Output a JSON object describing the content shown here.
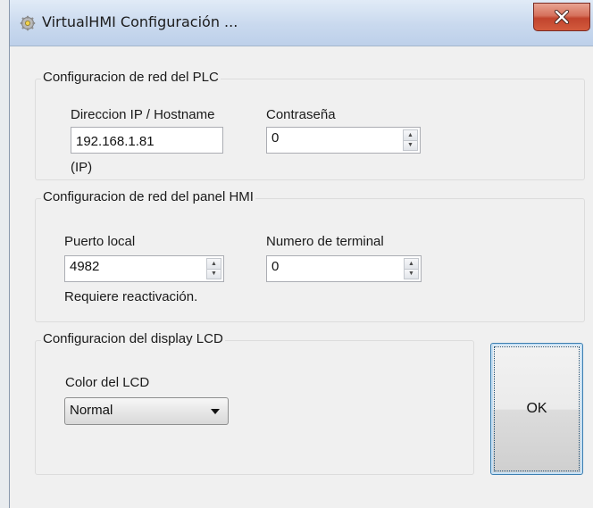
{
  "window": {
    "title": "VirtualHMI Configuración ...",
    "app_icon": "gear-icon",
    "close_icon": "close-icon"
  },
  "plc_group": {
    "title": "Configuracion de red del PLC",
    "ip_label": "Direccion IP / Hostname",
    "ip_value": "192.168.1.81",
    "ip_hint": "(IP)",
    "password_label": "Contraseña",
    "password_value": "0"
  },
  "hmi_group": {
    "title": "Configuracion de red del panel HMI",
    "port_label": "Puerto local",
    "port_value": "4982",
    "port_hint": "Requiere reactivación.",
    "terminal_label": "Numero de terminal",
    "terminal_value": "0"
  },
  "lcd_group": {
    "title": "Configuracion del display LCD",
    "color_label": "Color del LCD",
    "color_value": "Normal"
  },
  "ok_button": {
    "label": "OK"
  },
  "colors": {
    "close_button": "#c1442d",
    "titlebar": "#c9d9ee",
    "focus": "#3c7fb1"
  }
}
